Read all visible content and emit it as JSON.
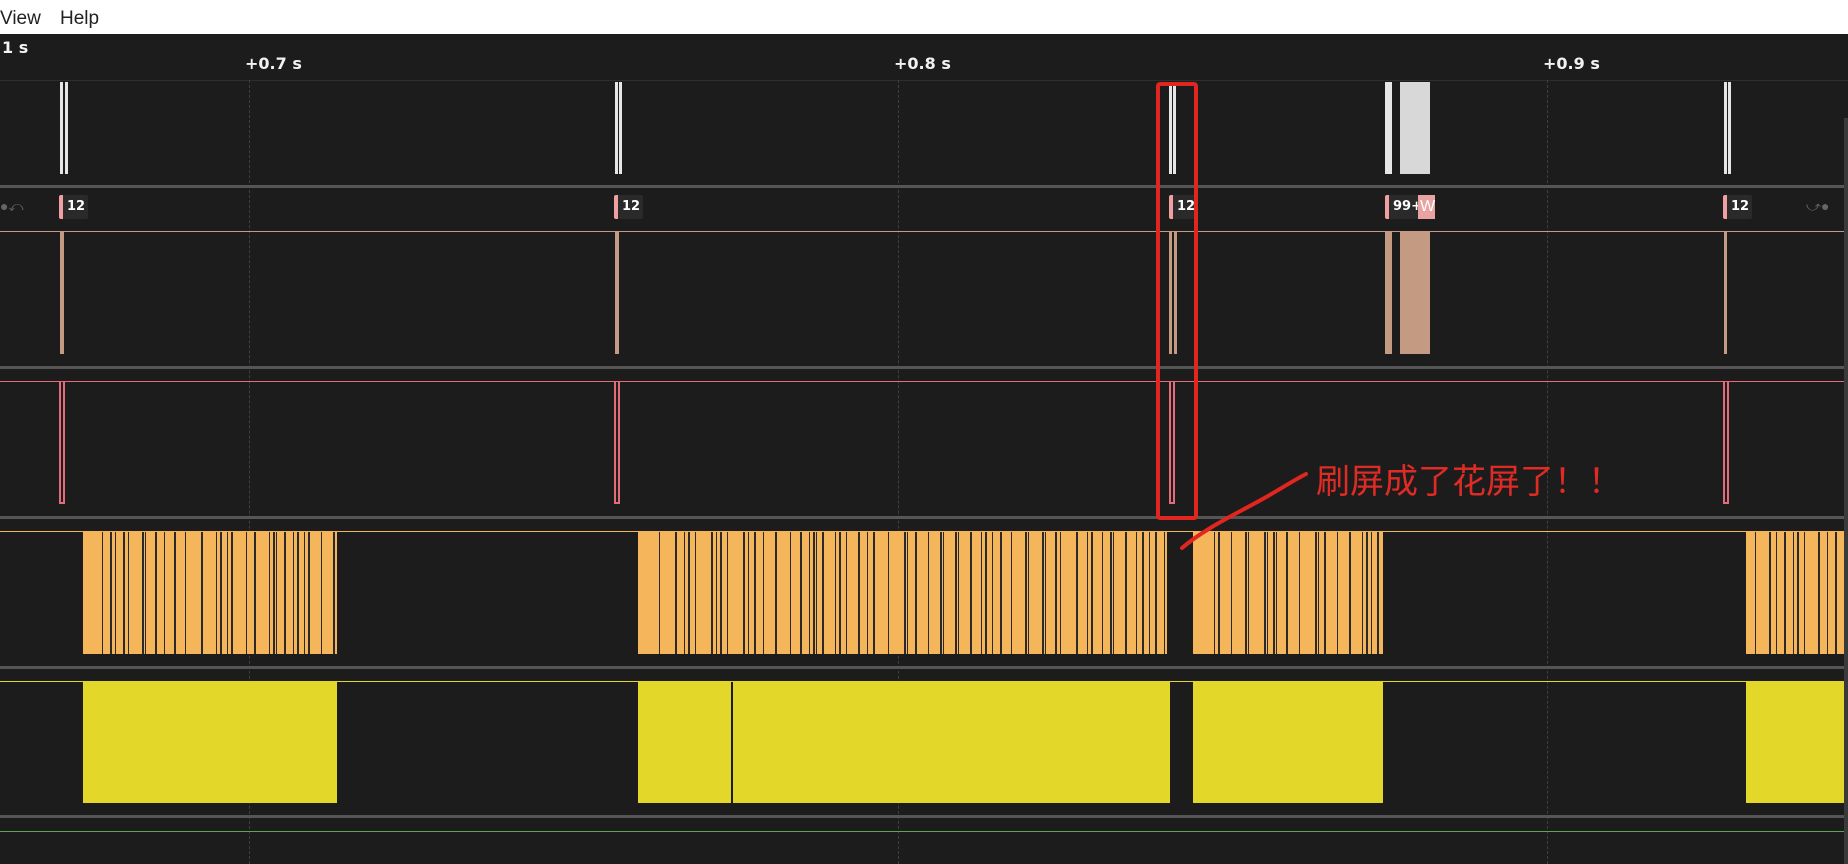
{
  "menu": {
    "view": "View",
    "help": "Help"
  },
  "ruler": {
    "start_label": "1 s",
    "ticks": [
      "+0.7 s",
      "+0.8 s",
      "+0.9 s"
    ]
  },
  "badges": [
    "12",
    "12",
    "12",
    "99+",
    "12"
  ],
  "badge_suffix": "W",
  "annotation": {
    "text": "刷屏成了花屏了！！"
  },
  "colors": {
    "background": "#1c1c1c",
    "white_track": "#e6e6e6",
    "peach_track": "#c49a82",
    "pink_track": "#e26d78",
    "orange_track": "#f5b55a",
    "yellow_track": "#e3d72a",
    "green_track": "#58a85a",
    "annotation_red": "#e0261f"
  }
}
